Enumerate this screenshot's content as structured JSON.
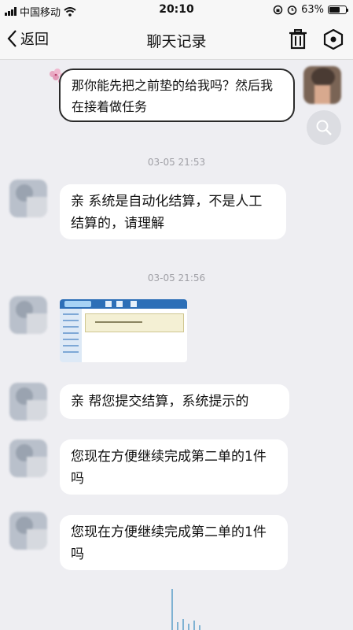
{
  "status_bar": {
    "carrier": "中国移动",
    "time": "20:10",
    "battery_text": "63%",
    "battery_level": 0.63
  },
  "nav": {
    "back_label": "返回",
    "title": "聊天记录"
  },
  "messages": [
    {
      "side": "right",
      "text": "那你能先把之前垫的给我吗？然后我在接着做任务"
    },
    {
      "timestamp": "03-05 21:53"
    },
    {
      "side": "left",
      "text": "亲 系统是自动化结算，不是人工结算的，请理解"
    },
    {
      "timestamp": "03-05 21:56"
    },
    {
      "side": "left",
      "type": "image"
    },
    {
      "side": "left",
      "text": "亲 帮您提交结算，系统提示的"
    },
    {
      "side": "left",
      "text": "您现在方便继续完成第二单的1件吗"
    },
    {
      "side": "left",
      "text": "您现在方便继续完成第二单的1件吗"
    }
  ],
  "colors": {
    "background": "#eeeef2",
    "bubble": "#ffffff",
    "timestamp": "#a0a0a6"
  }
}
